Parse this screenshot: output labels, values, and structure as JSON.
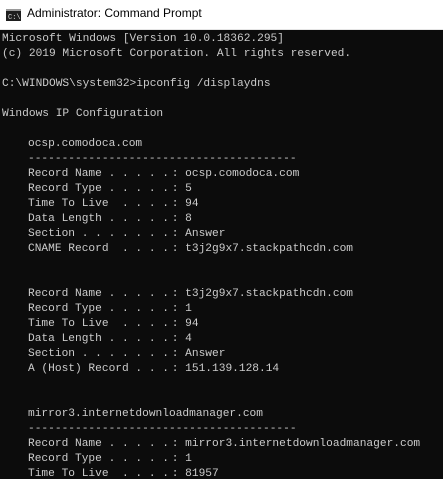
{
  "window": {
    "title": "Administrator: Command Prompt",
    "icon": "cmd-icon"
  },
  "console": {
    "banner_line1": "Microsoft Windows [Version 10.0.18362.295]",
    "banner_line2": "(c) 2019 Microsoft Corporation. All rights reserved.",
    "prompt_line": "C:\\WINDOWS\\system32>ipconfig /displaydns",
    "header": "Windows IP Configuration",
    "separator": "----------------------------------------",
    "entries": [
      {
        "name": "ocsp.comodoca.com",
        "fields": [
          {
            "label": "Record Name . . . . .",
            "value": "ocsp.comodoca.com"
          },
          {
            "label": "Record Type . . . . .",
            "value": "5"
          },
          {
            "label": "Time To Live  . . . .",
            "value": "94"
          },
          {
            "label": "Data Length . . . . .",
            "value": "8"
          },
          {
            "label": "Section . . . . . . .",
            "value": "Answer"
          },
          {
            "label": "CNAME Record  . . . .",
            "value": "t3j2g9x7.stackpathcdn.com"
          }
        ]
      },
      {
        "name": "",
        "fields": [
          {
            "label": "Record Name . . . . .",
            "value": "t3j2g9x7.stackpathcdn.com"
          },
          {
            "label": "Record Type . . . . .",
            "value": "1"
          },
          {
            "label": "Time To Live  . . . .",
            "value": "94"
          },
          {
            "label": "Data Length . . . . .",
            "value": "4"
          },
          {
            "label": "Section . . . . . . .",
            "value": "Answer"
          },
          {
            "label": "A (Host) Record . . .",
            "value": "151.139.128.14"
          }
        ]
      },
      {
        "name": "mirror3.internetdownloadmanager.com",
        "fields": [
          {
            "label": "Record Name . . . . .",
            "value": "mirror3.internetdownloadmanager.com"
          },
          {
            "label": "Record Type . . . . .",
            "value": "1"
          },
          {
            "label": "Time To Live  . . . .",
            "value": "81957"
          }
        ]
      }
    ]
  }
}
